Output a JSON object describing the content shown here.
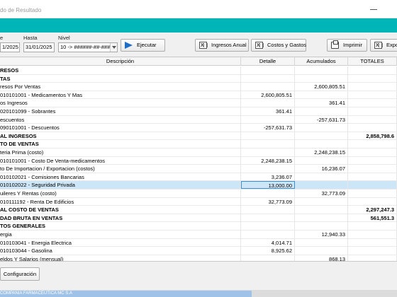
{
  "window": {
    "title": "do de Resultado",
    "accent_color": "#00b5b8"
  },
  "filters": {
    "from_label": "e",
    "from_value": "1/2025",
    "to_label": "Hasta",
    "to_value": "31/01/2025",
    "level_label": "Nivel",
    "level_value": "10 -> ######-##-###",
    "run_button": "Ejecutar"
  },
  "toolbar": {
    "annual_income": "Ingresos Anual",
    "costs_expenses": "Costos y Gastos",
    "print": "Imprimir",
    "export": "Expo"
  },
  "grid": {
    "columns": [
      "Descripción",
      "Detalle",
      "Acumulados",
      "TOTALES"
    ],
    "rows": [
      {
        "desc": "RESOS",
        "det": "",
        "acc": "",
        "tot": "",
        "bold": true
      },
      {
        "desc": "TAS",
        "det": "",
        "acc": "",
        "tot": "",
        "bold": true
      },
      {
        "desc": "resos  Por Ventas",
        "det": "",
        "acc": "2,600,805.51",
        "tot": "",
        "bold": false
      },
      {
        "desc": "010101001 - Medicamentos Y Mas",
        "det": "2,600,805.51",
        "acc": "",
        "tot": "",
        "bold": false
      },
      {
        "desc": "os Ingresos",
        "det": "",
        "acc": "361.41",
        "tot": "",
        "bold": false
      },
      {
        "desc": "020101099 - Sobrantes",
        "det": "361.41",
        "acc": "",
        "tot": "",
        "bold": false
      },
      {
        "desc": "escuentos",
        "det": "",
        "acc": "-257,631.73",
        "tot": "",
        "bold": false
      },
      {
        "desc": "090101001 - Descuentos",
        "det": "-257,631.73",
        "acc": "",
        "tot": "",
        "bold": false
      },
      {
        "desc": "AL INGRESOS",
        "det": "",
        "acc": "",
        "tot": "2,858,798.6",
        "bold": true
      },
      {
        "desc": "TO DE VENTAS",
        "det": "",
        "acc": "",
        "tot": "",
        "bold": true
      },
      {
        "desc": "teria Prima (costo)",
        "det": "",
        "acc": "2,248,238.15",
        "tot": "",
        "bold": false
      },
      {
        "desc": "010101001 - Costo De Venta-medicamentos",
        "det": "2,248,238.15",
        "acc": "",
        "tot": "",
        "bold": false
      },
      {
        "desc": "to De Importacion / Exportacion (costos)",
        "det": "",
        "acc": "16,236.07",
        "tot": "",
        "bold": false
      },
      {
        "desc": "010102021 - Comisiones Bancarias",
        "det": "3,236.07",
        "acc": "",
        "tot": "",
        "bold": false
      },
      {
        "desc": "010102022 - Seguridad Privada",
        "det": "13,000.00",
        "acc": "",
        "tot": "",
        "bold": false,
        "selected": true
      },
      {
        "desc": "uileres Y Rentas (costo)",
        "det": "",
        "acc": "32,773.09",
        "tot": "",
        "bold": false
      },
      {
        "desc": "010111192 - Renta De Edificios",
        "det": "32,773.09",
        "acc": "",
        "tot": "",
        "bold": false
      },
      {
        "desc": "AL COSTO DE VENTAS",
        "det": "",
        "acc": "",
        "tot": "2,297,247.3",
        "bold": true
      },
      {
        "desc": "DAD BRUTA EN VENTAS",
        "det": "",
        "acc": "",
        "tot": "561,551.3",
        "bold": true
      },
      {
        "desc": "TOS GENERALES",
        "det": "",
        "acc": "",
        "tot": "",
        "bold": true
      },
      {
        "desc": "ergia",
        "det": "",
        "acc": "12,940.33",
        "tot": "",
        "bold": false
      },
      {
        "desc": "010103041 - Energia Electrica",
        "det": "4,014.71",
        "acc": "",
        "tot": "",
        "bold": false
      },
      {
        "desc": "010103044 - Gasolina",
        "det": "8,925.62",
        "acc": "",
        "tot": "",
        "bold": false
      },
      {
        "desc": "eldos Y Salarios (mensual)",
        "det": "",
        "acc": "868.13",
        "tot": "",
        "bold": false
      }
    ]
  },
  "footer": {
    "config_button": "Configuración"
  },
  "taskbar": {
    "item": "COMPAÑIA FARMACEUTICA MC S.A"
  }
}
